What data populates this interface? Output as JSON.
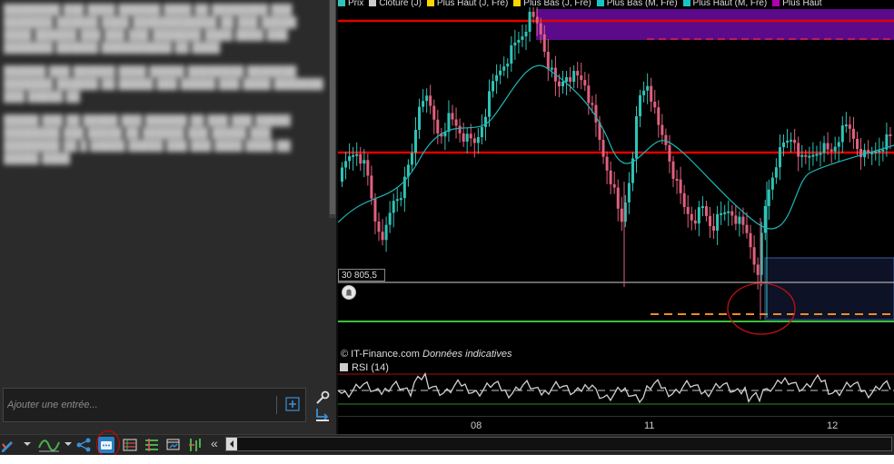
{
  "journal": {
    "entry_placeholder": "Ajouter une entrée..."
  },
  "chart": {
    "legend": [
      {
        "label": "Prix",
        "color": "#2ec4b6"
      },
      {
        "label": "Clôture (J)",
        "color": "#cccccc"
      },
      {
        "label": "Plus Haut (J, Fre)",
        "color": "#ffd700"
      },
      {
        "label": "Plus Bas (J, Fre)",
        "color": "#ffd700"
      },
      {
        "label": "Plus Bas (M, Fre)",
        "color": "#17c5c5"
      },
      {
        "label": "Plus Haut (M, Fre)",
        "color": "#17c5c5"
      },
      {
        "label": "Plus Haut",
        "color": "#b000b0"
      }
    ],
    "price_tag": "30 805,5",
    "copyright_source": "© IT-Finance.com",
    "copyright_note": "Données indicatives",
    "indicator_label": "RSI (14)",
    "x_ticks": [
      {
        "label": "08"
      },
      {
        "label": "11"
      },
      {
        "label": "12"
      }
    ],
    "colors": {
      "up_candle": "#2ec4b6",
      "down_candle": "#e0607e",
      "resistance": "#e00000",
      "support": "#3cbf3c",
      "moving_average": "#1fb5b5",
      "rsi_line": "#d0d0d0"
    }
  },
  "toolbar": {
    "icons": [
      "draw-tools-icon",
      "indicator-icon",
      "share-icon",
      "journal-icon",
      "table-icon",
      "list-icon",
      "window-icon",
      "compare-icon",
      "collapse-icon"
    ]
  }
}
